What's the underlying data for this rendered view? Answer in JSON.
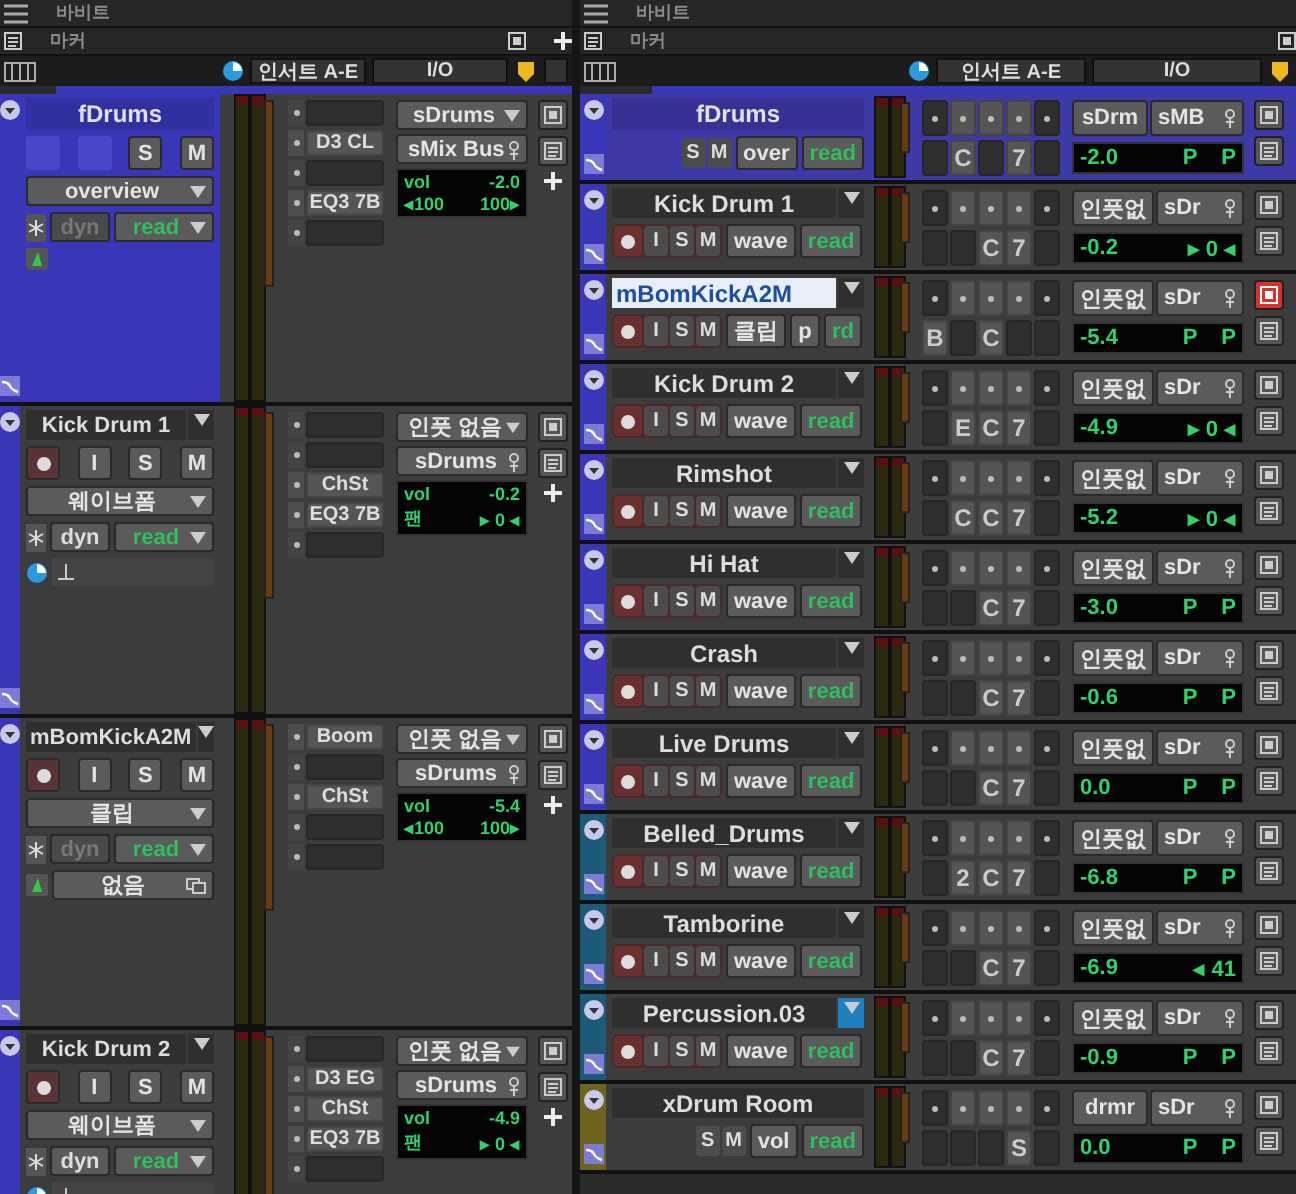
{
  "left_pane": {
    "ruler": "바비트",
    "marker": "마커",
    "columns": [
      "인서트 A-E",
      "I/O"
    ],
    "tracks": [
      {
        "name": "fDrums",
        "kind": "folder",
        "color": "#3a36b8",
        "buttons": [
          "S",
          "M"
        ],
        "view": "overview",
        "dyn": {
          "label": "dyn",
          "disabled": true
        },
        "automation": "read",
        "tool_row": {
          "kind": "instrument"
        },
        "inserts": [
          {
            "filled": false
          },
          {
            "filled": true,
            "label": "D3 CL"
          },
          {
            "filled": false
          },
          {
            "filled": true,
            "label": "EQ3 7B"
          },
          {
            "filled": false
          }
        ],
        "input": "sDrums",
        "output": "sMix Bus",
        "vol_label": "vol",
        "volume": "-2.0",
        "pan": [
          "◂100",
          "100▸"
        ]
      },
      {
        "name": "Kick Drum 1",
        "kind": "audio",
        "color": "#3a36b8",
        "buttons": [
          "I",
          "S",
          "M"
        ],
        "view": "웨이브폼",
        "dyn": {
          "label": "dyn",
          "disabled": false
        },
        "automation": "read",
        "tool_row": {
          "kind": "timebase"
        },
        "inserts": [
          {
            "filled": false
          },
          {
            "filled": false
          },
          {
            "filled": true,
            "label": "ChSt"
          },
          {
            "filled": true,
            "label": "EQ3 7B"
          },
          {
            "filled": false
          }
        ],
        "input": "인풋 없음",
        "output": "sDrums",
        "vol_label": "vol",
        "volume": "-0.2",
        "pan": [
          "팬",
          "▸ 0 ◂"
        ]
      },
      {
        "name": "mBomKickA2M",
        "kind": "audio",
        "color": "#3a36b8",
        "buttons": [
          "I",
          "S",
          "M"
        ],
        "view": "클립",
        "dyn": {
          "label": "dyn",
          "disabled": true
        },
        "automation": "read",
        "tool_row": {
          "kind": "instrument"
        },
        "playlist": "없음",
        "inserts": [
          {
            "filled": true,
            "label": "Boom"
          },
          {
            "filled": false
          },
          {
            "filled": true,
            "label": "ChSt"
          },
          {
            "filled": false
          },
          {
            "filled": false
          }
        ],
        "input": "인풋 없음",
        "output": "sDrums",
        "vol_label": "vol",
        "volume": "-5.4",
        "pan": [
          "◂100",
          "100▸"
        ]
      },
      {
        "name": "Kick Drum 2",
        "kind": "audio",
        "color": "#3a36b8",
        "buttons": [
          "I",
          "S",
          "M"
        ],
        "view": "웨이브폼",
        "dyn": {
          "label": "dyn",
          "disabled": false
        },
        "automation": "read",
        "tool_row": {
          "kind": "timebase"
        },
        "inserts": [
          {
            "filled": false
          },
          {
            "filled": true,
            "label": "D3 EG"
          },
          {
            "filled": true,
            "label": "ChSt"
          },
          {
            "filled": true,
            "label": "EQ3 7B"
          },
          {
            "filled": false
          }
        ],
        "input": "인풋 없음",
        "output": "sDrums",
        "vol_label": "vol",
        "volume": "-4.9",
        "pan": [
          "팬",
          "▸ 0 ◂"
        ]
      }
    ]
  },
  "right_pane": {
    "ruler": "바비트",
    "marker": "마커",
    "columns": [
      "인서트 A-E",
      "I/O"
    ],
    "tracks": [
      {
        "name": "fDrums",
        "kind": "folder",
        "selected": false,
        "color": "#3a36b8",
        "buttons": [
          "S",
          "M"
        ],
        "view": [
          "over"
        ],
        "automation": "read",
        "slots": [
          {
            "filled": false
          },
          {
            "filled": true,
            "label": "C"
          },
          {
            "filled": false
          },
          {
            "filled": true,
            "label": "7"
          },
          {
            "filled": false
          }
        ],
        "input": "sDrm",
        "output": "sMB",
        "volume": "-2.0",
        "pan": [
          "P",
          "P"
        ],
        "io_alert": false
      },
      {
        "name": "Kick Drum 1",
        "kind": "audio",
        "selected": false,
        "color": "#3a36b8",
        "buttons": [
          "I",
          "S",
          "M"
        ],
        "view": [
          "wave"
        ],
        "automation": "read",
        "slots": [
          {
            "filled": false
          },
          {
            "filled": false
          },
          {
            "filled": true,
            "label": "C"
          },
          {
            "filled": true,
            "label": "7"
          },
          {
            "filled": false
          }
        ],
        "input": "인풋없",
        "output": "sDr",
        "volume": "-0.2",
        "pan": [
          "▸ 0 ◂"
        ],
        "io_alert": false
      },
      {
        "name": "mBomKickA2M",
        "kind": "audio",
        "selected": true,
        "color": "#3a36b8",
        "buttons": [
          "I",
          "S",
          "M"
        ],
        "view": [
          "클립",
          "p"
        ],
        "automation": "rd",
        "slots": [
          {
            "filled": true,
            "label": "B"
          },
          {
            "filled": false
          },
          {
            "filled": true,
            "label": "C"
          },
          {
            "filled": false
          },
          {
            "filled": false
          }
        ],
        "input": "인풋없",
        "output": "sDr",
        "volume": "-5.4",
        "pan": [
          "P",
          "P"
        ],
        "io_alert": true
      },
      {
        "name": "Kick Drum 2",
        "kind": "audio",
        "selected": false,
        "color": "#3a36b8",
        "buttons": [
          "I",
          "S",
          "M"
        ],
        "view": [
          "wave"
        ],
        "automation": "read",
        "slots": [
          {
            "filled": false
          },
          {
            "filled": true,
            "label": "E"
          },
          {
            "filled": true,
            "label": "C"
          },
          {
            "filled": true,
            "label": "7"
          },
          {
            "filled": false
          }
        ],
        "input": "인풋없",
        "output": "sDr",
        "volume": "-4.9",
        "pan": [
          "▸ 0 ◂"
        ],
        "io_alert": false
      },
      {
        "name": "Rimshot",
        "kind": "audio",
        "selected": false,
        "color": "#3a36b8",
        "buttons": [
          "I",
          "S",
          "M"
        ],
        "view": [
          "wave"
        ],
        "automation": "read",
        "slots": [
          {
            "filled": false
          },
          {
            "filled": true,
            "label": "C"
          },
          {
            "filled": true,
            "label": "C"
          },
          {
            "filled": true,
            "label": "7"
          },
          {
            "filled": false
          }
        ],
        "input": "인풋없",
        "output": "sDr",
        "volume": "-5.2",
        "pan": [
          "▸ 0 ◂"
        ],
        "io_alert": false
      },
      {
        "name": "Hi Hat",
        "kind": "audio",
        "selected": false,
        "color": "#3a36b8",
        "buttons": [
          "I",
          "S",
          "M"
        ],
        "view": [
          "wave"
        ],
        "automation": "read",
        "slots": [
          {
            "filled": false
          },
          {
            "filled": false
          },
          {
            "filled": true,
            "label": "C"
          },
          {
            "filled": true,
            "label": "7"
          },
          {
            "filled": false
          }
        ],
        "input": "인풋없",
        "output": "sDr",
        "volume": "-3.0",
        "pan": [
          "P",
          "P"
        ],
        "io_alert": false
      },
      {
        "name": "Crash",
        "kind": "audio",
        "selected": false,
        "color": "#3a36b8",
        "buttons": [
          "I",
          "S",
          "M"
        ],
        "view": [
          "wave"
        ],
        "automation": "read",
        "slots": [
          {
            "filled": false
          },
          {
            "filled": false
          },
          {
            "filled": true,
            "label": "C"
          },
          {
            "filled": true,
            "label": "7"
          },
          {
            "filled": false
          }
        ],
        "input": "인풋없",
        "output": "sDr",
        "volume": "-0.6",
        "pan": [
          "P",
          "P"
        ],
        "io_alert": false
      },
      {
        "name": "Live Drums",
        "kind": "audio",
        "selected": false,
        "color": "#3a36b8",
        "buttons": [
          "I",
          "S",
          "M"
        ],
        "view": [
          "wave"
        ],
        "automation": "read",
        "slots": [
          {
            "filled": false
          },
          {
            "filled": false
          },
          {
            "filled": true,
            "label": "C"
          },
          {
            "filled": true,
            "label": "7"
          },
          {
            "filled": false
          }
        ],
        "input": "인풋없",
        "output": "sDr",
        "volume": "0.0",
        "pan": [
          "P",
          "P"
        ],
        "io_alert": false
      },
      {
        "name": "Belled_Drums",
        "kind": "audio",
        "selected": false,
        "color": "#1d5a78",
        "buttons": [
          "I",
          "S",
          "M"
        ],
        "view": [
          "wave"
        ],
        "automation": "read",
        "slots": [
          {
            "filled": false
          },
          {
            "filled": true,
            "label": "2"
          },
          {
            "filled": true,
            "label": "C"
          },
          {
            "filled": true,
            "label": "7"
          },
          {
            "filled": false
          }
        ],
        "input": "인풋없",
        "output": "sDr",
        "volume": "-6.8",
        "pan": [
          "P",
          "P"
        ],
        "io_alert": false
      },
      {
        "name": "Tamborine",
        "kind": "audio",
        "selected": false,
        "color": "#1d5a78",
        "buttons": [
          "I",
          "S",
          "M"
        ],
        "view": [
          "wave"
        ],
        "automation": "read",
        "slots": [
          {
            "filled": false
          },
          {
            "filled": false
          },
          {
            "filled": true,
            "label": "C"
          },
          {
            "filled": true,
            "label": "7"
          },
          {
            "filled": false
          }
        ],
        "input": "인풋없",
        "output": "sDr",
        "volume": "-6.9",
        "pan": [
          "◂ 41"
        ],
        "io_alert": false
      },
      {
        "name": "Percussion.03",
        "kind": "audio",
        "selected": false,
        "color": "#1d5a78",
        "buttons": [
          "I",
          "S",
          "M"
        ],
        "view": [
          "wave"
        ],
        "automation": "read",
        "slots": [
          {
            "filled": false
          },
          {
            "filled": false
          },
          {
            "filled": true,
            "label": "C"
          },
          {
            "filled": true,
            "label": "7"
          },
          {
            "filled": false
          }
        ],
        "input": "인풋없",
        "output": "sDr",
        "volume": "-0.9",
        "pan": [
          "P",
          "P"
        ],
        "io_alert": false
      },
      {
        "name": "xDrum Room",
        "kind": "aux",
        "selected": false,
        "color": "#6e6420",
        "buttons": [
          "S",
          "M"
        ],
        "view": [
          "vol"
        ],
        "automation": "read",
        "slots": [
          {
            "filled": false
          },
          {
            "filled": false
          },
          {
            "filled": false
          },
          {
            "filled": true,
            "label": "S"
          },
          {
            "filled": false
          }
        ],
        "input": "drmr",
        "output": "sDr",
        "volume": "0.0",
        "pan": [
          "P",
          "P"
        ],
        "io_alert": false
      }
    ]
  }
}
